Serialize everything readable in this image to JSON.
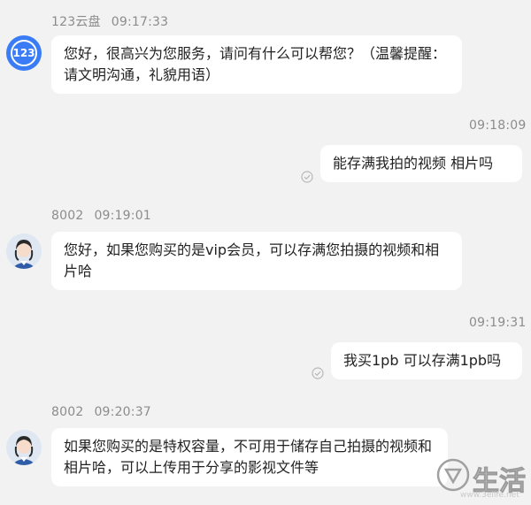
{
  "messages": [
    {
      "sender": "123云盘",
      "time": "09:17:33",
      "text": "您好，很高兴为您服务，请问有什么可以帮您？（温馨提醒：请文明沟通，礼貌用语）",
      "avatar_text": "123"
    },
    {
      "time": "09:18:09",
      "text": "能存满我拍的视频 相片吗"
    },
    {
      "sender": "8002",
      "time": "09:19:01",
      "text": "您好，如果您购买的是vip会员，可以存满您拍摄的视频和相片哈"
    },
    {
      "time": "09:19:31",
      "text": "我买1pb 可以存满1pb吗"
    },
    {
      "sender": "8002",
      "time": "09:20:37",
      "text": "如果您购买的是特权容量，不可用于储存自己拍摄的视频和相片哈，可以上传用于分享的影视文件等"
    }
  ],
  "watermark": {
    "text": "生活",
    "url": "www.3elife.net"
  },
  "colors": {
    "background": "#f2f2f2",
    "bubble": "#ffffff",
    "brand": "#3a7cf5",
    "meta": "#8c8c8c"
  }
}
